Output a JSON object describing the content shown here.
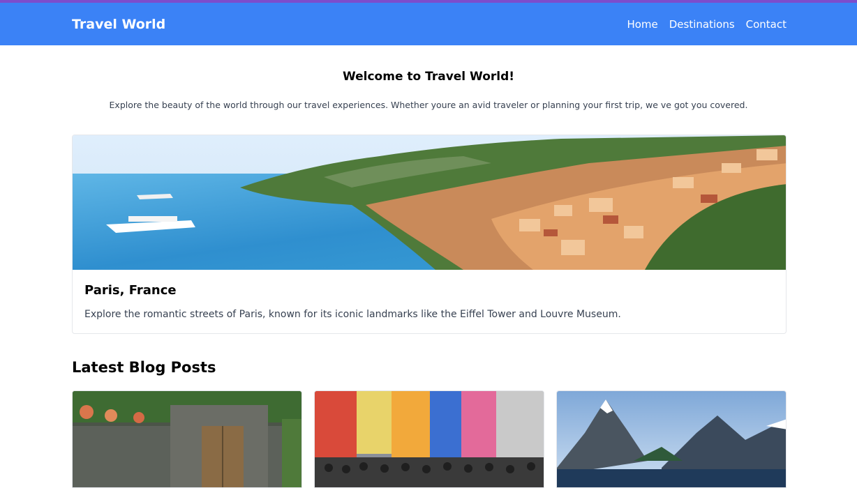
{
  "nav": {
    "brand": "Travel World",
    "links": [
      {
        "label": "Home"
      },
      {
        "label": "Destinations"
      },
      {
        "label": "Contact"
      }
    ]
  },
  "welcome": {
    "title": "Welcome to Travel World!",
    "text": "Explore the beauty of the world through our travel experiences. Whether youre an avid traveler or planning your first trip, we ve got you covered."
  },
  "featured": {
    "title": "Paris, France",
    "description": "Explore the romantic streets of Paris, known for its iconic landmarks like the Eiffel Tower and Louvre Museum."
  },
  "blog": {
    "heading": "Latest Blog Posts"
  },
  "colors": {
    "navbar": "#3b82f6",
    "accent_line": "#7c4dcc"
  }
}
